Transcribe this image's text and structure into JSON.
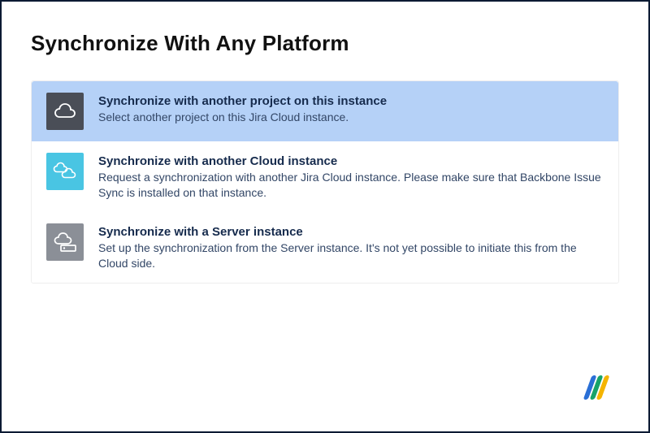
{
  "page_title": "Synchronize With Any Platform",
  "options": [
    {
      "icon_name": "cloud-icon",
      "icon_bg": "#4a4e57",
      "selected": true,
      "title": "Synchronize with another project on this instance",
      "description": "Select another project on this Jira Cloud instance."
    },
    {
      "icon_name": "cloud-pair-icon",
      "icon_bg": "#49c5e3",
      "selected": false,
      "title": "Synchronize with another Cloud instance",
      "description": "Request a synchronization with another Jira Cloud instance. Please make sure that Backbone Issue Sync is installed on that instance."
    },
    {
      "icon_name": "cloud-server-icon",
      "icon_bg": "#8b8f97",
      "selected": false,
      "title": "Synchronize with a Server instance",
      "description": "Set up the synchronization from the Server instance. It's not yet possible to initiate this from the Cloud side."
    }
  ],
  "logo_name": "backbone-logo"
}
